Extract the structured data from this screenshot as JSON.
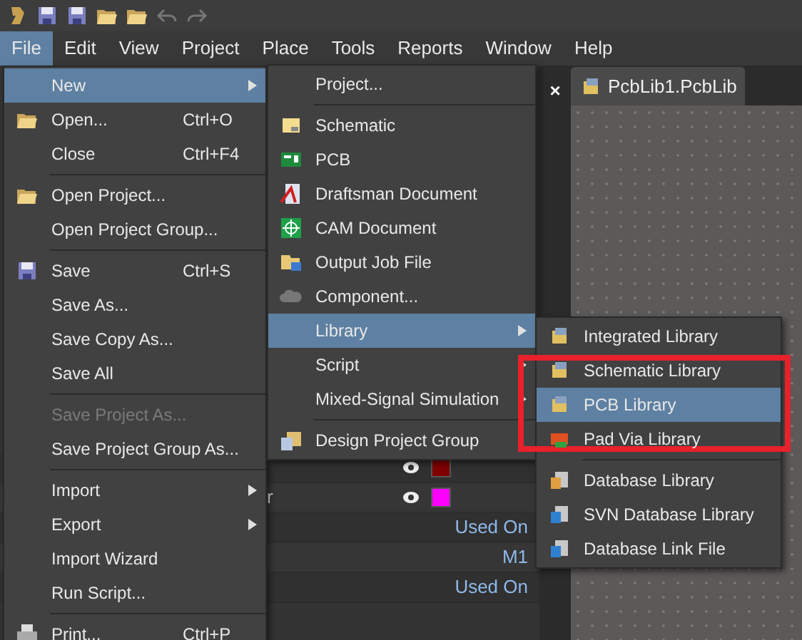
{
  "menubar": [
    {
      "label": "File",
      "selected": true
    },
    {
      "label": "Edit",
      "selected": false
    },
    {
      "label": "View",
      "selected": false
    },
    {
      "label": "Project",
      "selected": false
    },
    {
      "label": "Place",
      "selected": false
    },
    {
      "label": "Tools",
      "selected": false
    },
    {
      "label": "Reports",
      "selected": false
    },
    {
      "label": "Window",
      "selected": false
    },
    {
      "label": "Help",
      "selected": false
    }
  ],
  "document_tab": {
    "label": "PcbLib1.PcbLib",
    "close": "×"
  },
  "panel_rows": [
    {
      "kind": "layer",
      "text": "",
      "color": "#800000"
    },
    {
      "kind": "layer",
      "text": "r",
      "color": "#ff00ff"
    },
    {
      "kind": "value",
      "text": "Used On"
    },
    {
      "kind": "value",
      "text": "M1"
    },
    {
      "kind": "value",
      "text": "Used On"
    }
  ],
  "file_menu": [
    {
      "kind": "item",
      "label": "New",
      "submenu": true,
      "selected": true,
      "disabled": false
    },
    {
      "kind": "item",
      "label": "Open...",
      "shortcut": "Ctrl+O",
      "selected": false,
      "disabled": false
    },
    {
      "kind": "item",
      "label": "Close",
      "shortcut": "Ctrl+F4",
      "selected": false,
      "disabled": false
    },
    {
      "kind": "separator"
    },
    {
      "kind": "item",
      "label": "Open Project...",
      "selected": false,
      "disabled": false
    },
    {
      "kind": "item",
      "label": "Open Project Group...",
      "selected": false,
      "disabled": false
    },
    {
      "kind": "separator"
    },
    {
      "kind": "item",
      "label": "Save",
      "shortcut": "Ctrl+S",
      "selected": false,
      "disabled": false
    },
    {
      "kind": "item",
      "label": "Save As...",
      "selected": false,
      "disabled": false
    },
    {
      "kind": "item",
      "label": "Save Copy As...",
      "selected": false,
      "disabled": false
    },
    {
      "kind": "item",
      "label": "Save All",
      "selected": false,
      "disabled": false
    },
    {
      "kind": "separator"
    },
    {
      "kind": "item",
      "label": "Save Project As...",
      "selected": false,
      "disabled": true
    },
    {
      "kind": "item",
      "label": "Save Project Group As...",
      "selected": false,
      "disabled": false
    },
    {
      "kind": "separator"
    },
    {
      "kind": "item",
      "label": "Import",
      "submenu": true,
      "selected": false,
      "disabled": false
    },
    {
      "kind": "item",
      "label": "Export",
      "submenu": true,
      "selected": false,
      "disabled": false
    },
    {
      "kind": "item",
      "label": "Import Wizard",
      "selected": false,
      "disabled": false
    },
    {
      "kind": "item",
      "label": "Run Script...",
      "selected": false,
      "disabled": false
    },
    {
      "kind": "separator"
    },
    {
      "kind": "item",
      "label": "Print...",
      "shortcut": "Ctrl+P",
      "selected": false,
      "disabled": false
    }
  ],
  "new_menu": [
    {
      "kind": "item",
      "label": "Project...",
      "selected": false,
      "disabled": false
    },
    {
      "kind": "separator"
    },
    {
      "kind": "item",
      "label": "Schematic",
      "selected": false,
      "disabled": false
    },
    {
      "kind": "item",
      "label": "PCB",
      "selected": false,
      "disabled": false
    },
    {
      "kind": "item",
      "label": "Draftsman Document",
      "selected": false,
      "disabled": false
    },
    {
      "kind": "item",
      "label": "CAM Document",
      "selected": false,
      "disabled": false
    },
    {
      "kind": "item",
      "label": "Output Job File",
      "selected": false,
      "disabled": false
    },
    {
      "kind": "item",
      "label": "Component...",
      "selected": false,
      "disabled": false
    },
    {
      "kind": "item",
      "label": "Library",
      "submenu": true,
      "selected": true,
      "disabled": false
    },
    {
      "kind": "item",
      "label": "Script",
      "submenu": true,
      "selected": false,
      "disabled": false
    },
    {
      "kind": "item",
      "label": "Mixed-Signal Simulation",
      "submenu": true,
      "selected": false,
      "disabled": false
    },
    {
      "kind": "separator"
    },
    {
      "kind": "item",
      "label": "Design Project Group",
      "selected": false,
      "disabled": false
    }
  ],
  "library_menu": [
    {
      "kind": "item",
      "label": "Integrated Library",
      "selected": false,
      "disabled": false
    },
    {
      "kind": "item",
      "label": "Schematic Library",
      "selected": false,
      "disabled": false
    },
    {
      "kind": "item",
      "label": "PCB Library",
      "selected": true,
      "disabled": false,
      "annotated": true
    },
    {
      "kind": "item",
      "label": "Pad Via Library",
      "selected": false,
      "disabled": false
    },
    {
      "kind": "separator"
    },
    {
      "kind": "item",
      "label": "Database Library",
      "selected": false,
      "disabled": false
    },
    {
      "kind": "item",
      "label": "SVN Database Library",
      "selected": false,
      "disabled": false
    },
    {
      "kind": "item",
      "label": "Database Link File",
      "selected": false,
      "disabled": false
    }
  ]
}
